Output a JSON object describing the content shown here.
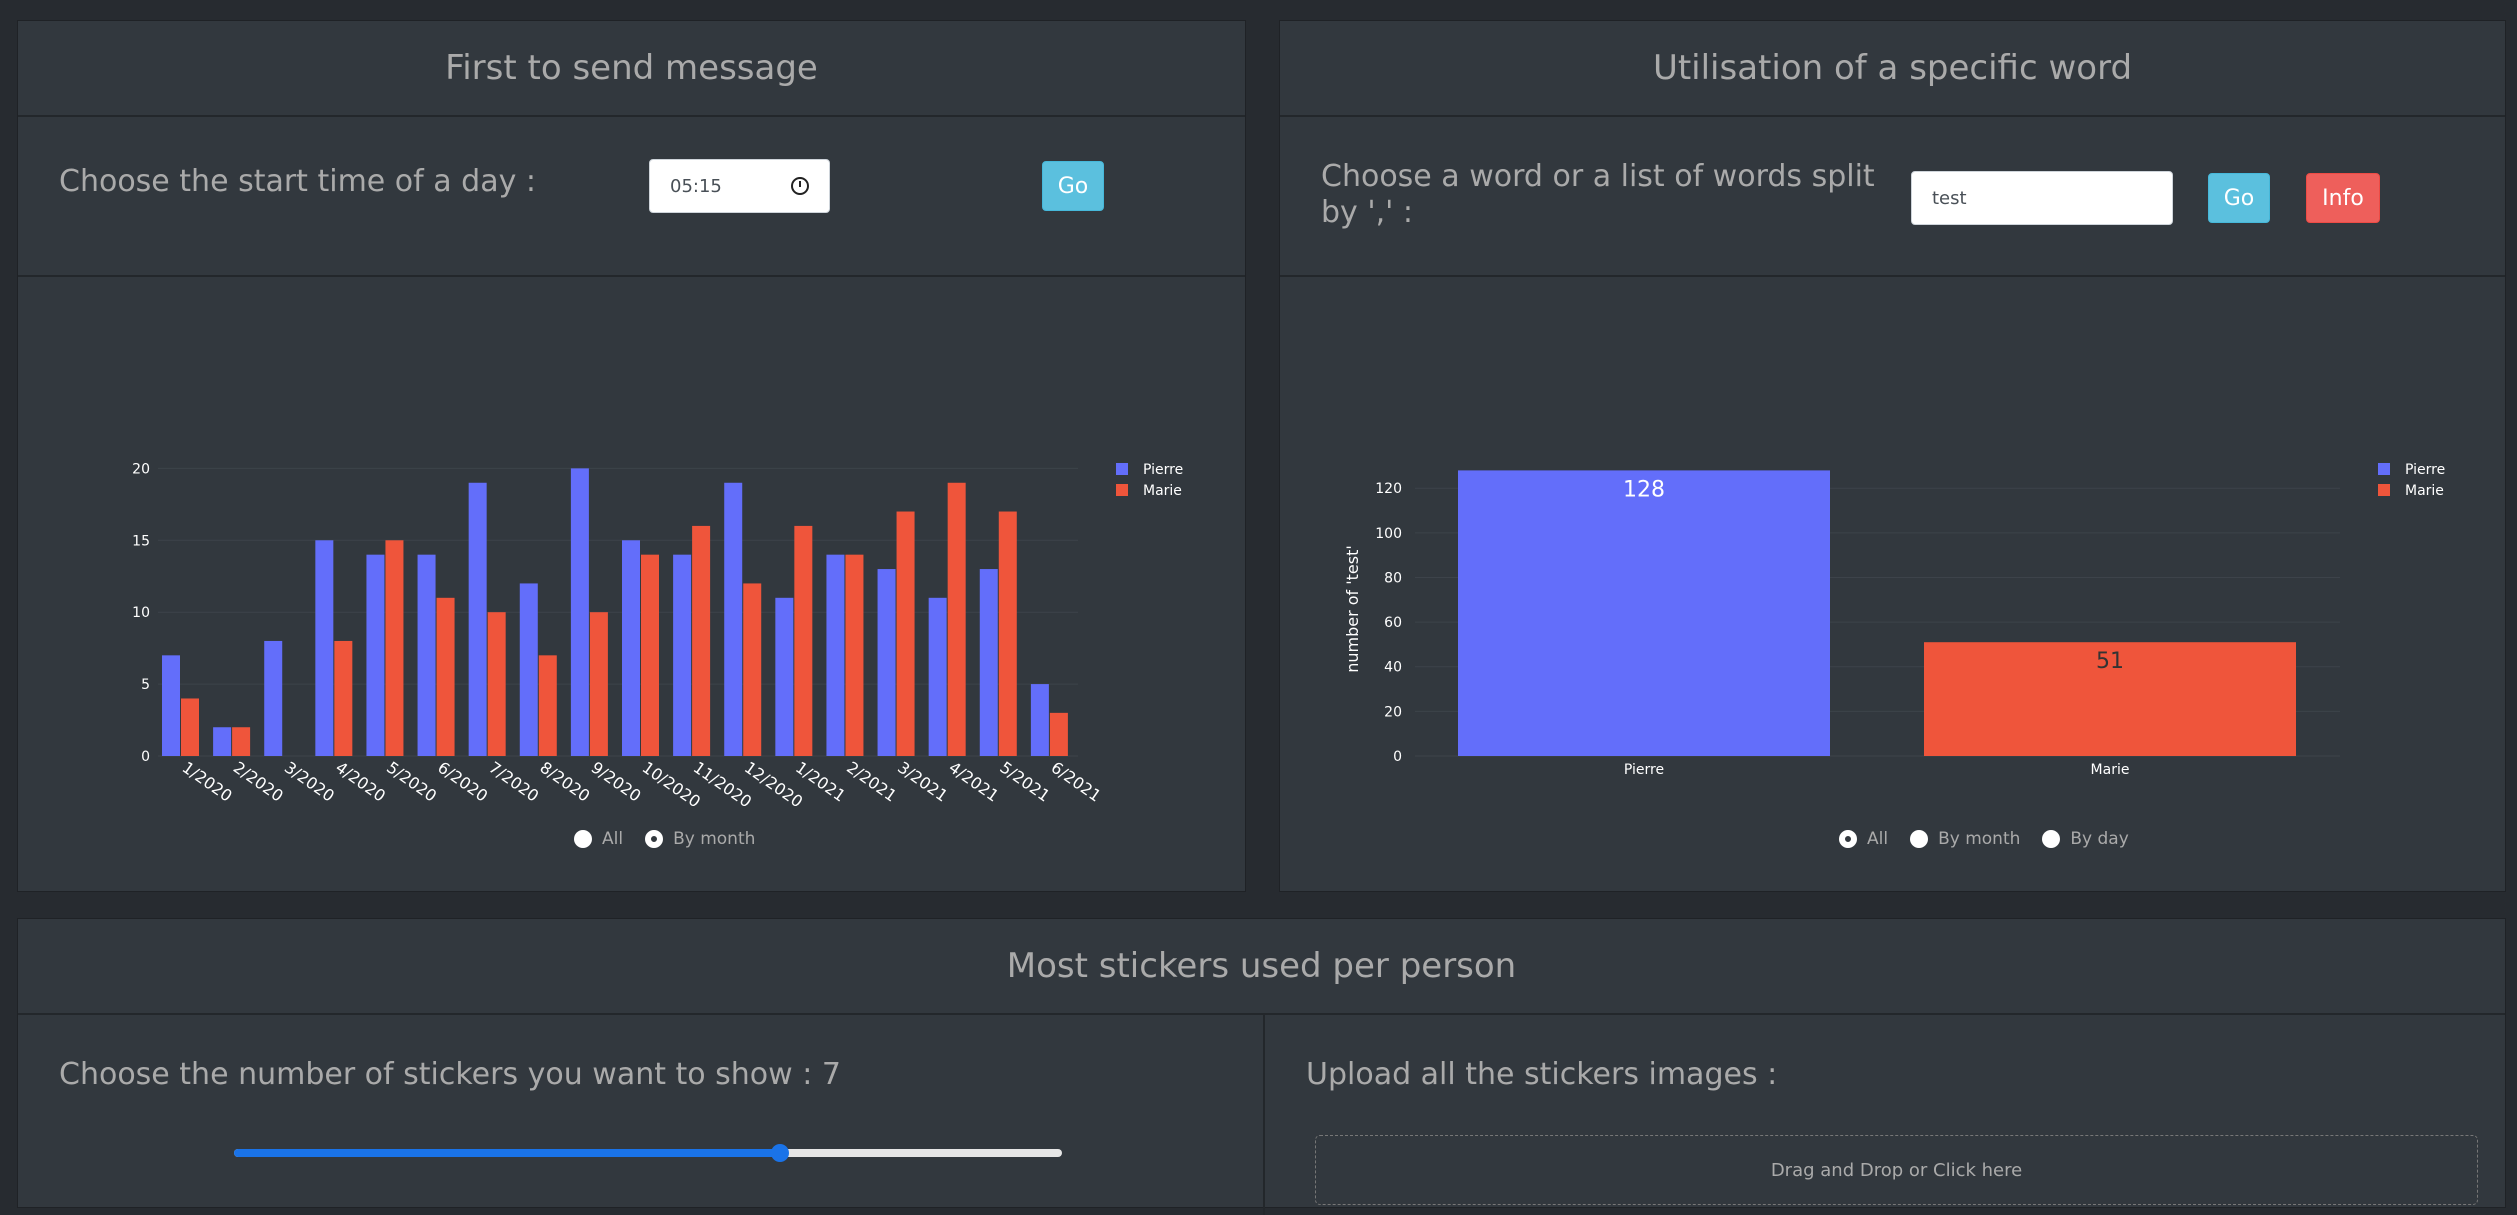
{
  "left_card": {
    "title": "First to send message",
    "label": "Choose the start time of a day :",
    "time_value": "05:15",
    "go_label": "Go",
    "radios": [
      {
        "label": "All",
        "checked": false
      },
      {
        "label": "By month",
        "checked": true
      }
    ]
  },
  "right_card": {
    "title": "Utilisation of a specific word",
    "label": "Choose a word or a list of words split by ',' :",
    "word_value": "test",
    "go_label": "Go",
    "info_label": "Info",
    "radios": [
      {
        "label": "All",
        "checked": true
      },
      {
        "label": "By month",
        "checked": false
      },
      {
        "label": "By day",
        "checked": false
      }
    ]
  },
  "bottom_card": {
    "title": "Most stickers used per person",
    "slider_label": "Choose the number of stickers you want to show : 7",
    "slider_fraction": 0.66,
    "upload_label": "Upload all the stickers images :",
    "drop_text": "Drag and Drop or Click here"
  },
  "colors": {
    "pierre": "#636efa",
    "marie": "#ef553b",
    "accent": "#1a73e8"
  },
  "chart_data": [
    {
      "type": "bar",
      "categories": [
        "1/2020",
        "2/2020",
        "3/2020",
        "4/2020",
        "5/2020",
        "6/2020",
        "7/2020",
        "8/2020",
        "9/2020",
        "10/2020",
        "11/2020",
        "12/2020",
        "1/2021",
        "2/2021",
        "3/2021",
        "4/2021",
        "5/2021",
        "6/2021"
      ],
      "series": [
        {
          "name": "Pierre",
          "values": [
            7,
            2,
            8,
            15,
            14,
            14,
            19,
            12,
            20,
            15,
            14,
            19,
            11,
            14,
            13,
            11,
            13,
            5
          ]
        },
        {
          "name": "Marie",
          "values": [
            4,
            2,
            0,
            8,
            15,
            11,
            10,
            7,
            10,
            14,
            16,
            12,
            16,
            14,
            17,
            19,
            17,
            3
          ]
        }
      ],
      "yticks": [
        0,
        5,
        10,
        15,
        20
      ],
      "ylim": [
        0,
        21
      ],
      "legend": "top-right"
    },
    {
      "type": "bar",
      "categories": [
        "Pierre",
        "Marie"
      ],
      "values": [
        128,
        51
      ],
      "data_labels": [
        "128",
        "51"
      ],
      "ylabel": "number of 'test'",
      "yticks": [
        0,
        20,
        40,
        60,
        80,
        100,
        120
      ],
      "ylim": [
        0,
        134
      ],
      "legend_entries": [
        "Pierre",
        "Marie"
      ],
      "legend": "top-right"
    }
  ]
}
